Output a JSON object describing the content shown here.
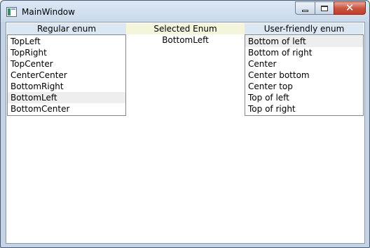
{
  "window": {
    "title": "MainWindow",
    "buttons": {
      "minimize": "minimize",
      "maximize": "maximize",
      "close": "✕"
    }
  },
  "left": {
    "header": "Regular enum",
    "items": [
      "TopLeft",
      "TopRight",
      "TopCenter",
      "CenterCenter",
      "BottomRight",
      "BottomLeft",
      "BottomCenter"
    ],
    "selected_index": 5
  },
  "middle": {
    "header": "Selected Enum",
    "value": "BottomLeft"
  },
  "right": {
    "header": "User-friendly enum",
    "items": [
      "Bottom of left",
      "Bottom of right",
      "Center",
      "Center bottom",
      "Center top",
      "Top of left",
      "Top of right"
    ],
    "selected_index": 0
  },
  "colors": {
    "header_bg": "#dbe8f4",
    "mid_header_bg": "#f5f5dc",
    "selection_bg": "#eeeeee"
  }
}
